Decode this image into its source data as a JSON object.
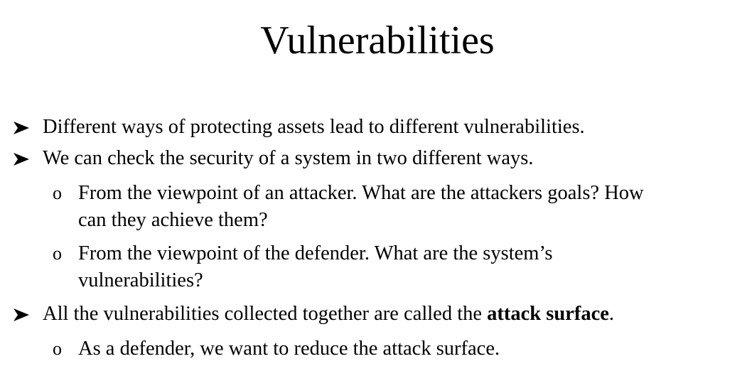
{
  "slide": {
    "title": "Vulnerabilities",
    "bullets": [
      {
        "text": "Different ways of protecting assets lead to different vulnerabilities."
      },
      {
        "text": "We can check the security of a system in two different ways.",
        "subs": [
          {
            "line1": "From the viewpoint of an attacker.  What are the attackers goals?  How",
            "line2": "can they achieve them?"
          },
          {
            "line1": "From the viewpoint of the defender.  What are the system’s",
            "line2": "vulnerabilities?"
          }
        ]
      },
      {
        "text_before": "All the vulnerabilities collected together are called the ",
        "text_bold": "attack surface",
        "text_after": ".",
        "subs": [
          {
            "line1": "As a defender, we want to reduce the attack surface."
          }
        ]
      }
    ],
    "bullet_symbol": "➢",
    "sub_bullet_symbol": "o"
  }
}
